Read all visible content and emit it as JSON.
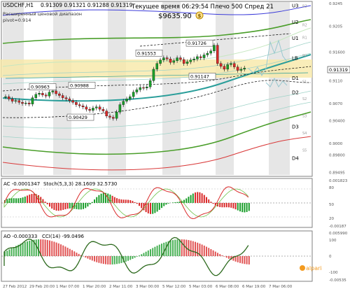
{
  "header": {
    "symbol": "USDCHF,H1",
    "ohlc": "0.91309 0.91321 0.91288 0.91319",
    "info_lines": [
      "Расширенный ценовой диапазон",
      "pivot=0.914"
    ],
    "time_label": "Текущее время 06:29:54 Плечо 500 Спред 21",
    "balance": "$9635.90",
    "balance_icon": "dollar-badge-icon"
  },
  "levels": [
    {
      "label": "U3",
      "value": 0.9242
    },
    {
      "label": "U2",
      "value": 0.9213
    },
    {
      "label": "U1",
      "value": 0.9185
    },
    {
      "label": "LB",
      "value": 0.915
    },
    {
      "label": "D1",
      "value": 0.9115
    },
    {
      "label": "D2",
      "value": 0.909
    },
    {
      "label": "D3",
      "value": 0.903
    },
    {
      "label": "D4",
      "value": 0.8975
    }
  ],
  "pivot_labels": [
    {
      "label": "R3",
      "value": 0.9242
    },
    {
      "label": "R2",
      "value": 0.9209
    },
    {
      "label": "R1",
      "value": 0.9187
    },
    {
      "label": "PP",
      "value": 0.9155
    },
    {
      "label": "S1",
      "value": 0.911
    },
    {
      "label": "S2",
      "value": 0.908
    },
    {
      "label": "S3",
      "value": 0.905
    },
    {
      "label": "S4",
      "value": 0.902
    },
    {
      "label": "S5",
      "value": 0.899
    }
  ],
  "price_axis": [
    "0.9245",
    "0.9205",
    "0.91600",
    "0.91319",
    "0.9110",
    "0.9070",
    "0.90400",
    "0.9000",
    "0.89800",
    "0.89495"
  ],
  "current_price": "0.91319",
  "ac_panel": {
    "label": "AC -0.0001347",
    "stoch": "Stoch(5,3,3) 28.1609 32.5730",
    "axis": [
      "0.001823",
      "80",
      "50",
      "20",
      "-0.00187"
    ]
  },
  "ao_panel": {
    "label": "AO -0.000333",
    "cci": "CCI(14) -99.0496",
    "axis": [
      "0.005990",
      "100",
      "0",
      "-100",
      "-0.00535"
    ]
  },
  "time_axis": [
    "27 Feb 2012",
    "29 Feb 20:00",
    "1 Mar 07:00",
    "1 Mar 20:00",
    "2 Mar 11:00",
    "3 Mar 00:00",
    "5 Mar 12:00",
    "5 Mar 03:00",
    "6 Mar 08:00",
    "6 Mar 19:00",
    "7 Mar 06:00"
  ],
  "brand": "alpari",
  "chart_data": {
    "type": "candlestick",
    "title": "USDCHF,H1",
    "ylim": [
      0.8945,
      0.9245
    ],
    "annotations": [
      {
        "text": "0.90963",
        "value": 0.90963
      },
      {
        "text": "0.90988",
        "value": 0.90988
      },
      {
        "text": "0.90429",
        "value": 0.90429
      },
      {
        "text": "0.91553",
        "value": 0.91553
      },
      {
        "text": "0.91726",
        "value": 0.91726
      },
      {
        "text": "0.91147",
        "value": 0.91147
      }
    ],
    "close_series": [
      0.9082,
      0.9078,
      0.9074,
      0.9075,
      0.9072,
      0.907,
      0.9071,
      0.9069,
      0.908,
      0.9086,
      0.9088,
      0.9085,
      0.9083,
      0.909,
      0.9092,
      0.9087,
      0.9084,
      0.908,
      0.9078,
      0.9075,
      0.9072,
      0.9068,
      0.9066,
      0.9064,
      0.906,
      0.9058,
      0.9062,
      0.9064,
      0.906,
      0.9057,
      0.9048,
      0.9046,
      0.9044,
      0.9055,
      0.9068,
      0.9074,
      0.9078,
      0.9082,
      0.909,
      0.9094,
      0.9098,
      0.9097,
      0.9099,
      0.911,
      0.913,
      0.914,
      0.9146,
      0.915,
      0.9148,
      0.9142,
      0.9145,
      0.915,
      0.9147,
      0.914,
      0.9143,
      0.9146,
      0.9148,
      0.9152,
      0.915,
      0.9155,
      0.9158,
      0.9162,
      0.9172,
      0.914,
      0.9135,
      0.913,
      0.9138,
      0.914,
      0.9134,
      0.9128,
      0.913,
      0.9132
    ]
  }
}
